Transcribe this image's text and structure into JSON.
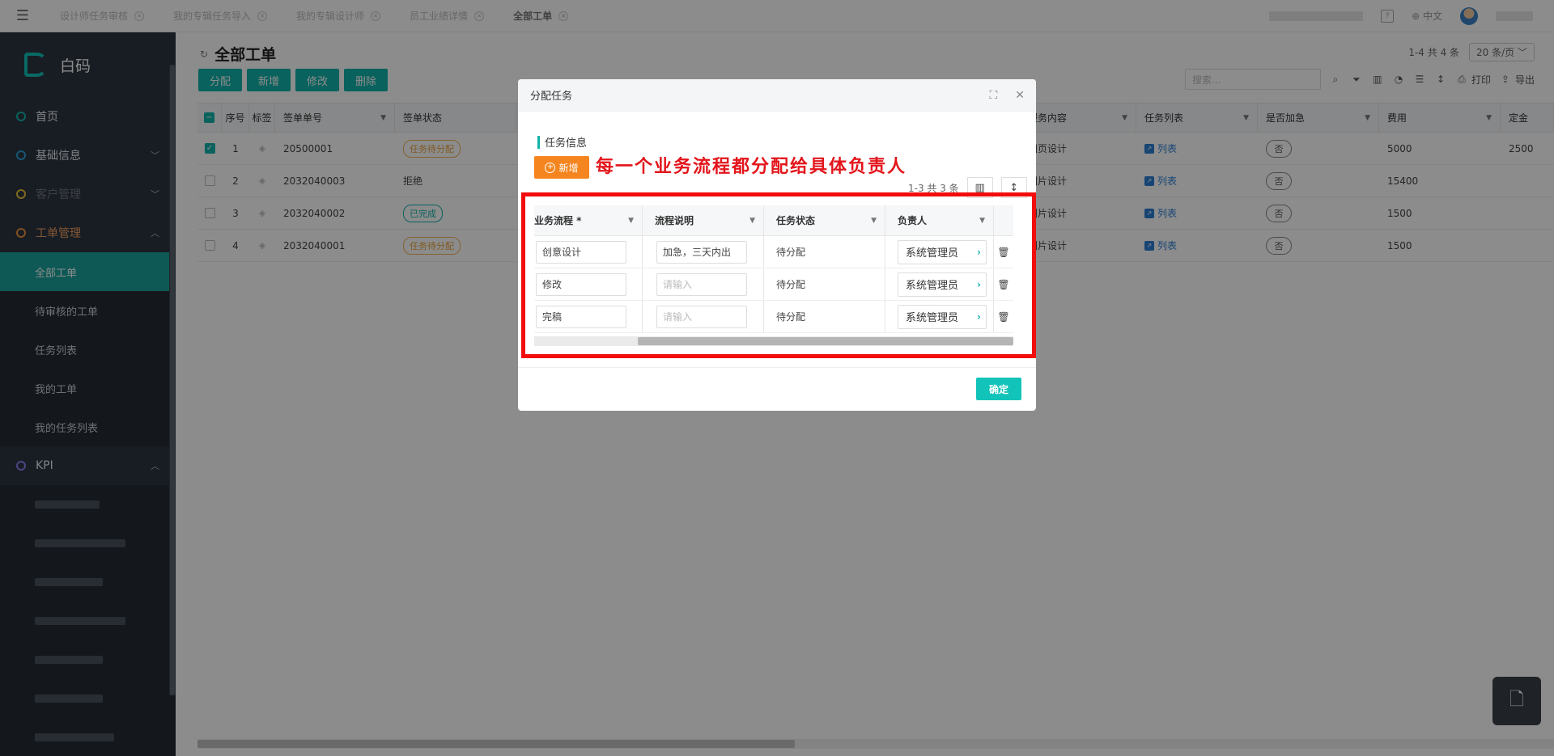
{
  "topbar": {
    "tabs": [
      "设计师任务审核",
      "我的专辑任务导入",
      "我的专辑设计师",
      "员工业绩详情",
      "全部工单"
    ],
    "lang": "中文"
  },
  "sidebar": {
    "logo": "白码",
    "items": [
      {
        "label": "首页",
        "color": "#12b3aa"
      },
      {
        "label": "基础信息",
        "color": "#2a9fd6"
      },
      {
        "label": "客户管理",
        "color": "#e8c23b"
      },
      {
        "label": "工单管理",
        "color": "#e8923b"
      }
    ],
    "sub_items": [
      "全部工单",
      "待审核的工单",
      "任务列表",
      "我的工单",
      "我的任务列表"
    ],
    "kpi_label": "KPI",
    "kpi_color": "#8b7cf0"
  },
  "main": {
    "title": "全部工单",
    "pager": "1-4 共 4 条",
    "page_size": "20 条/页",
    "toolbar": {
      "assign": "分配",
      "add": "新增",
      "edit": "修改",
      "delete": "删除"
    },
    "search_placeholder": "搜索...",
    "print": "打印",
    "export": "导出",
    "columns": {
      "idx": "序号",
      "tag": "标签",
      "num": "签单单号",
      "status": "签单状态",
      "content": "服务内容",
      "tasks": "任务列表",
      "urgent": "是否加急",
      "fee": "费用",
      "deposit": "定金"
    },
    "rows": [
      {
        "idx": "1",
        "num": "20500001",
        "status": "任务待分配",
        "content": "网页设计",
        "tasks": "列表",
        "urgent": "否",
        "fee": "5000",
        "deposit": "2500"
      },
      {
        "idx": "2",
        "num": "2032040003",
        "status": "拒绝",
        "content": "图片设计",
        "tasks": "列表",
        "urgent": "否",
        "fee": "15400",
        "deposit": ""
      },
      {
        "idx": "3",
        "num": "2032040002",
        "status": "已完成",
        "content": "图片设计",
        "tasks": "列表",
        "urgent": "否",
        "fee": "1500",
        "deposit": ""
      },
      {
        "idx": "4",
        "num": "2032040001",
        "status": "任务待分配",
        "content": "图片设计",
        "tasks": "列表",
        "urgent": "否",
        "fee": "1500",
        "deposit": ""
      }
    ]
  },
  "modal": {
    "title": "分配任务",
    "section": "任务信息",
    "add_label": "新增",
    "annotation": "每一个业务流程都分配给具体负责人",
    "pager": "1-3 共 3 条",
    "columns": {
      "flow": "业务流程 *",
      "desc": "流程说明",
      "state": "任务状态",
      "owner": "负责人"
    },
    "rows": [
      {
        "flow": "创意设计",
        "desc": "加急，三天内出",
        "state": "待分配",
        "owner": "系统管理员"
      },
      {
        "flow": "修改",
        "desc": "",
        "state": "待分配",
        "owner": "系统管理员"
      },
      {
        "flow": "完稿",
        "desc": "",
        "state": "待分配",
        "owner": "系统管理员"
      }
    ],
    "desc_placeholder": "请输入",
    "ok": "确定"
  },
  "colors": {
    "accent": "#12b3aa",
    "orange": "#f5851f",
    "annotation_red": "#e3151b",
    "sidebar_bg": "#2c3440"
  }
}
